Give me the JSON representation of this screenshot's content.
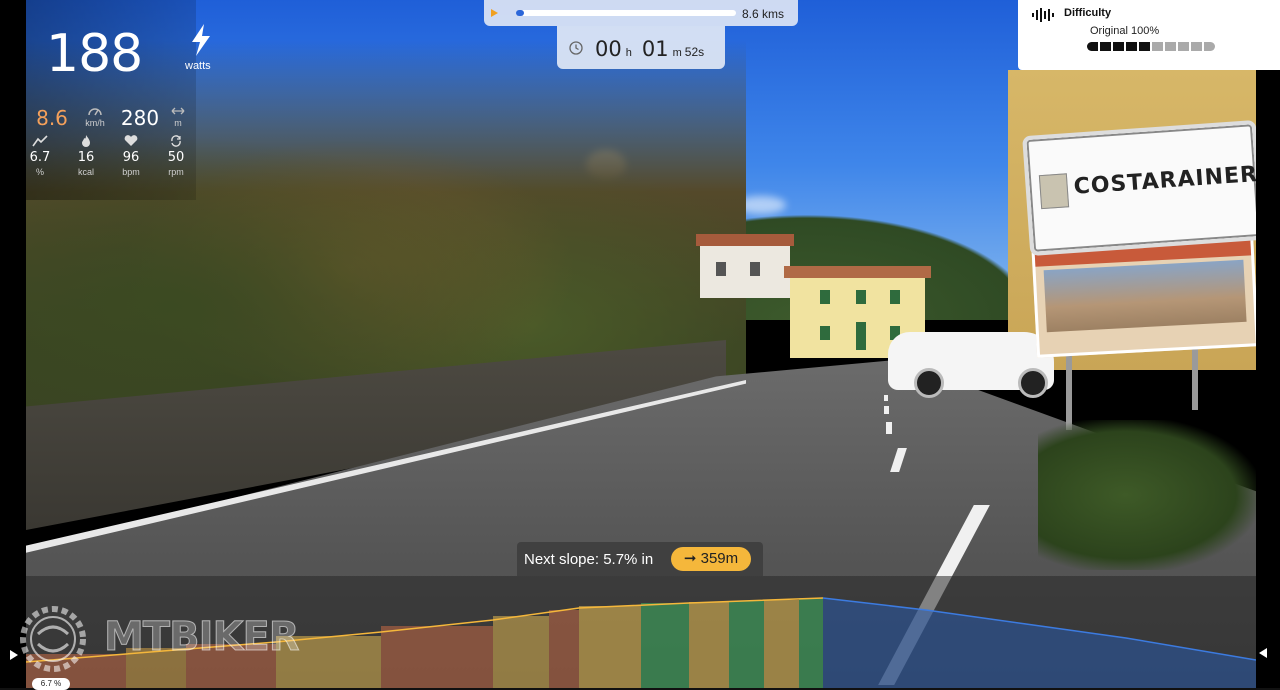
{
  "power": {
    "value": "188",
    "unit": "watts",
    "icon": "bolt-icon"
  },
  "stats_row1": [
    {
      "name": "speed",
      "value": "8.6",
      "unit": "km/h",
      "color": "#f5a05a",
      "icon": "speedometer-icon"
    },
    {
      "name": "distance",
      "value": "280",
      "unit": "m",
      "color": "#ffffff",
      "icon": "distance-arrows-icon"
    }
  ],
  "stats_row2": [
    {
      "name": "grade",
      "value": "6.7",
      "unit": "%",
      "icon": "slope-icon"
    },
    {
      "name": "calories",
      "value": "16",
      "unit": "kcal",
      "icon": "flame-icon"
    },
    {
      "name": "heart-rate",
      "value": "96",
      "unit": "bpm",
      "icon": "heart-icon"
    },
    {
      "name": "cadence",
      "value": "50",
      "unit": "rpm",
      "icon": "cadence-cycle-icon"
    }
  ],
  "route": {
    "distance_label": "8.6 kms",
    "progress": 0.03,
    "accent": "#2b66d9"
  },
  "timer": {
    "hours": "00",
    "hours_unit": "h",
    "minutes": "01",
    "minutes_unit": "m",
    "seconds": "52s"
  },
  "difficulty": {
    "title": "Difficulty",
    "value": "Original 100%",
    "level": 5,
    "segments": 10,
    "icon": "difficulty-equalizer-icon"
  },
  "next_slope": {
    "label": "Next slope: 5.7% in",
    "distance": "➞ 359m",
    "pill_color": "#f5b73b"
  },
  "profile": {
    "current_grade": "6.7 %",
    "position": 0.0
  },
  "scene": {
    "town_sign": "COSTARAINERA"
  },
  "watermark": "MTBIKER"
}
